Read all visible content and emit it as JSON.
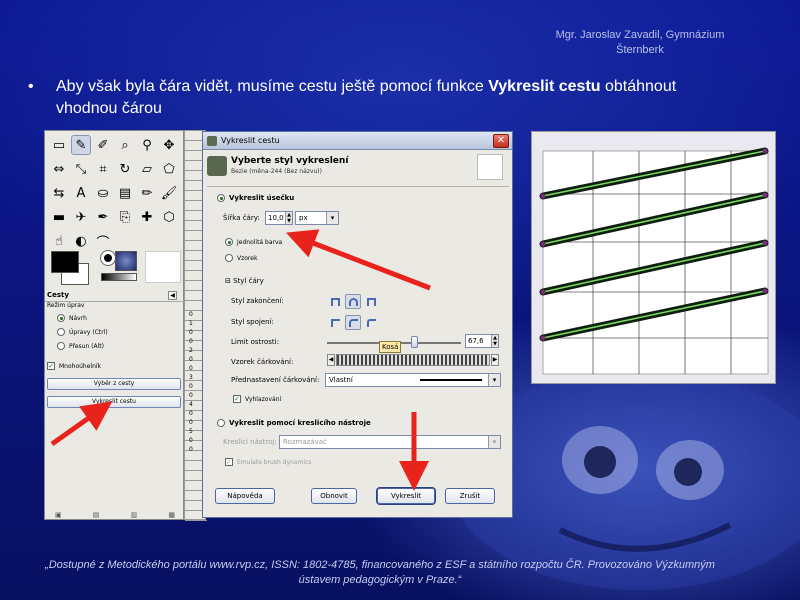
{
  "header": {
    "author_line1": "Mgr. Jaroslav Zavadil, Gymnázium",
    "author_line2": "Šternberk"
  },
  "bullet": {
    "symbol": "•",
    "text_before": "Aby však byla čára vidět, musíme cestu ještě pomocí funkce ",
    "text_bold": "Vykreslit cestu",
    "text_after": " obtáhnout vhodnou čárou"
  },
  "toolbox": {
    "paths_title": "Cesty",
    "mode_label": "Režim úprav",
    "modes": [
      {
        "label": "Návrh",
        "selected": true
      },
      {
        "label": "Úpravy (Ctrl)",
        "selected": false
      },
      {
        "label": "Přesun (Alt)",
        "selected": false
      }
    ],
    "polygonal_label": "Mnohoúhelník",
    "polygonal_checked": true,
    "selection_button": "Výběr z cesty",
    "stroke_button": "Vykreslit cestu",
    "tool_icons": [
      "rect-select",
      "lasso",
      "color-picker",
      "zoom",
      "measure",
      "move",
      "align",
      "scale",
      "crop",
      "rotate",
      "shear",
      "perspective",
      "flip",
      "text",
      "bucket-fill",
      "blend",
      "pencil",
      "paintbrush",
      "eraser",
      "airbrush",
      "ink",
      "clone",
      "heal",
      "perspective-clone",
      "smudge",
      "dodge",
      "path"
    ]
  },
  "ruler": {
    "ticks": [
      "0",
      "1",
      "0",
      "0",
      "2",
      "0",
      "0",
      "3",
      "0",
      "0",
      "4",
      "0",
      "0",
      "5",
      "0",
      "0"
    ]
  },
  "dialog": {
    "title": "Vykreslit cestu",
    "heading": "Vyberte styl vykreslení",
    "subheading": "Bezie (měna-244 (Bez názvu))",
    "option_line": "Vykreslit úsečku",
    "option_line_selected": true,
    "width_label": "Šířka čáry:",
    "width_value": "10,0",
    "width_unit": "px",
    "solid_label": "Jednolitá barva",
    "solid_selected": true,
    "pattern_label": "Vzorek",
    "line_style_label": "Styl čáry",
    "cap_label": "Styl zakončení:",
    "join_label": "Styl spojení:",
    "miter_label": "Limit ostrosti:",
    "miter_value": "67,6",
    "tooltip": "Kosá",
    "dash_label": "Vzorek čárkování:",
    "dash_preset_label": "Přednastavení čárkování:",
    "dash_preset_value": "Vlastní",
    "antialias_label": "Vyhlazování",
    "antialias_checked": true,
    "option_tool": "Vykreslit pomocí kreslicího nástroje",
    "option_tool_selected": false,
    "paint_tool_label": "Kreslicí nástroj:",
    "paint_tool_value": "Rozmazávač",
    "emulate_label": "Emulate brush dynamics",
    "buttons": {
      "help": "Nápověda",
      "reset": "Obnovit",
      "stroke": "Vykreslit",
      "cancel": "Zrušit"
    },
    "close_symbol": "✕"
  },
  "canvas": {
    "stroke_color": "#0f1f0f",
    "highlight_color": "#7bdc62"
  },
  "colors": {
    "arrow": "#e8231c",
    "slide_bg": "#0a1580"
  },
  "footer": {
    "line1": "„Dostupné z Metodického portálu www.rvp.cz, ISSN: 1802-4785, financovaného z ESF a státního rozpočtu ČR. Provozováno Výzkumným",
    "line2": "ústavem pedagogickým v Praze.“"
  }
}
